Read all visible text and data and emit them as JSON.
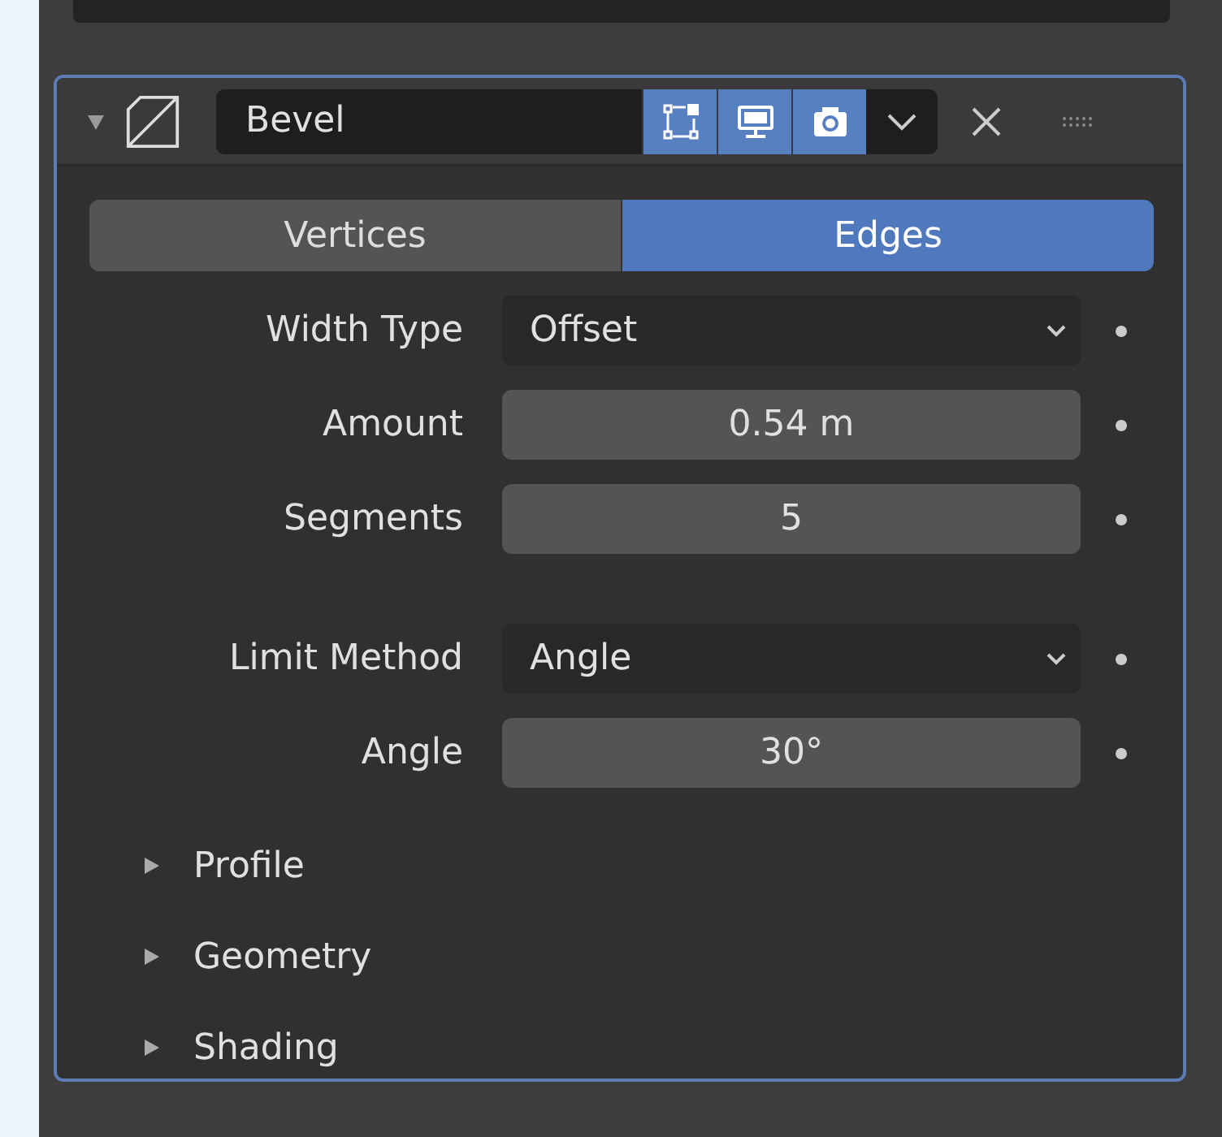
{
  "modifier": {
    "expanded": true,
    "name": "Bevel",
    "toggles": [
      {
        "kind": "editmode",
        "on": true
      },
      {
        "kind": "viewport",
        "on": true
      },
      {
        "kind": "render",
        "on": true
      }
    ]
  },
  "tabs": [
    {
      "label": "Vertices",
      "selected": false
    },
    {
      "label": "Edges",
      "selected": true
    }
  ],
  "properties": [
    {
      "kind": "dropdown",
      "label": "Width Type",
      "value": "Offset"
    },
    {
      "kind": "number",
      "label": "Amount",
      "value": "0.54 m"
    },
    {
      "kind": "number",
      "label": "Segments",
      "value": "5"
    },
    {
      "kind": "spacer"
    },
    {
      "kind": "dropdown",
      "label": "Limit Method",
      "value": "Angle"
    },
    {
      "kind": "number",
      "label": "Angle",
      "value": "30°"
    }
  ],
  "subpanels": [
    {
      "label": "Profile",
      "expanded": false
    },
    {
      "label": "Geometry",
      "expanded": false
    },
    {
      "label": "Shading",
      "expanded": false
    }
  ]
}
